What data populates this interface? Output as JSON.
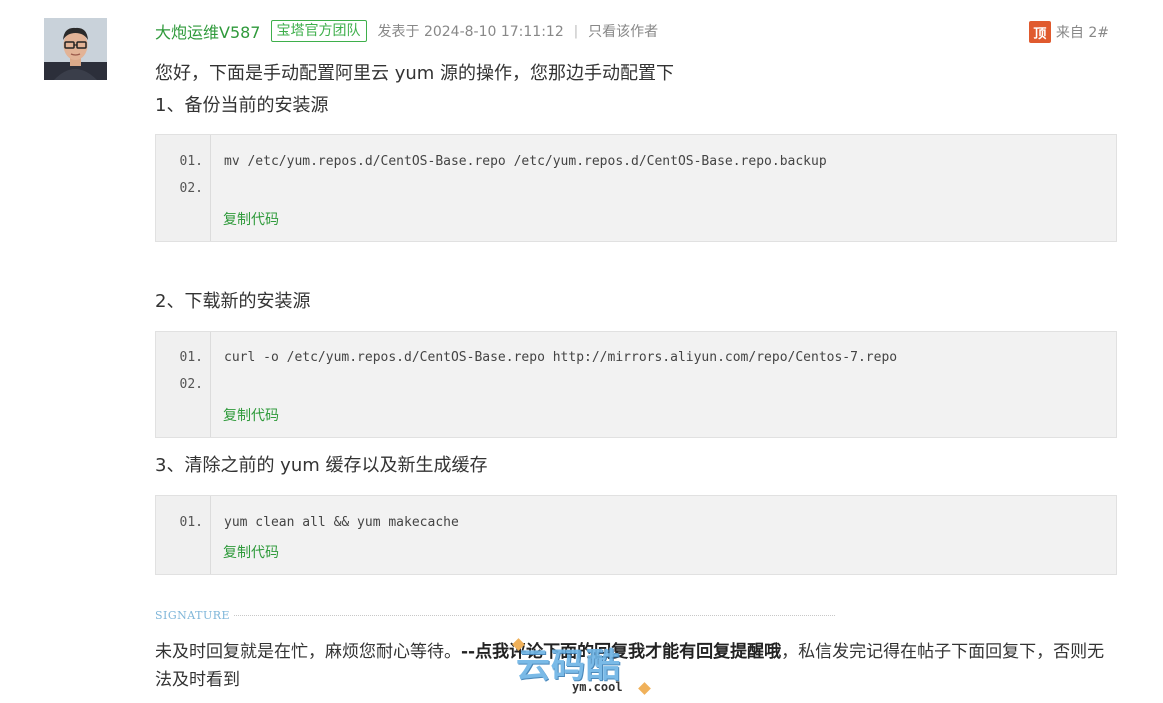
{
  "post": {
    "author": "大炮运维V587",
    "badge": "宝塔官方团队",
    "posted_at": "发表于 2024-8-10 17:11:12",
    "separator": "|",
    "only_author": "只看该作者",
    "top_icon": "顶",
    "floor": "来自 2#"
  },
  "content": {
    "intro": "您好，下面是手动配置阿里云 yum 源的操作，您那边手动配置下",
    "steps": [
      {
        "title": "1、备份当前的安装源",
        "lines": [
          {
            "num": "01.",
            "code": "mv /etc/yum.repos.d/CentOS-Base.repo /etc/yum.repos.d/CentOS-Base.repo.backup"
          },
          {
            "num": "02.",
            "code": ""
          }
        ],
        "copy_label": "复制代码"
      },
      {
        "title": "2、下载新的安装源",
        "lines": [
          {
            "num": "01.",
            "code": "curl -o /etc/yum.repos.d/CentOS-Base.repo http://mirrors.aliyun.com/repo/Centos-7.repo"
          },
          {
            "num": "02.",
            "code": ""
          }
        ],
        "copy_label": "复制代码"
      },
      {
        "title": "3、清除之前的 yum 缓存以及新生成缓存",
        "lines": [
          {
            "num": "01.",
            "code": "yum clean all && yum makecache"
          }
        ],
        "copy_label": "复制代码"
      }
    ]
  },
  "signature": {
    "label": "SIGNATURE",
    "text_before": "未及时回复就是在忙，麻烦您耐心等待。",
    "text_bold": "--点我评论下面的回复我才能有回复提醒哦",
    "text_after": "，私信发完记得在帖子下面回复下，否则无法及时看到"
  },
  "watermark": {
    "main": "云码酷",
    "sub": "ym.cool"
  },
  "colors": {
    "author_green": "#2f9a3b",
    "badge_green": "#3eaf4b",
    "top_icon_bg": "#e05a2e",
    "code_bg": "#f2f2f2"
  }
}
